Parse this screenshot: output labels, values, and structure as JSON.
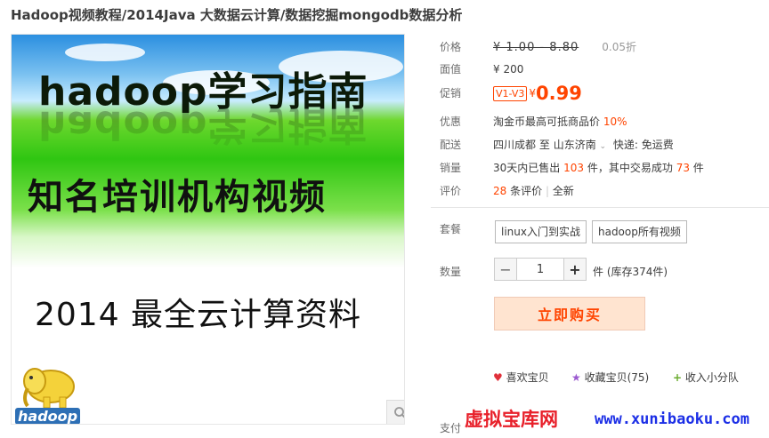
{
  "title": "Hadoop视频教程/2014Java 大数据云计算/数据挖掘mongodb数据分析",
  "image": {
    "heading": "hadoop学习指南",
    "subheading": "知名培训机构视频",
    "tagline": "2014 最全云计算资料",
    "logo_text": "hadoop"
  },
  "price": {
    "label": "价格",
    "original": "¥ 1.00 - 8.80",
    "discount": "0.05折"
  },
  "face_value": {
    "label": "面值",
    "value": "¥ 200"
  },
  "promo": {
    "label": "促销",
    "tag": "V1-V3",
    "currency": "¥",
    "price": "0.99"
  },
  "benefit": {
    "label": "优惠",
    "text": "淘金币最高可抵商品价",
    "percent": "10%"
  },
  "shipping": {
    "label": "配送",
    "from": "四川成都",
    "to_word": "至",
    "dest": "山东济南",
    "express": "快递: 免运费"
  },
  "sales": {
    "label": "销量",
    "prefix": "30天内已售出",
    "sold": "103",
    "mid": "件，其中交易成功",
    "success": "73",
    "suffix": "件"
  },
  "rating": {
    "label": "评价",
    "count": "28",
    "text": "条评价",
    "sep": "|",
    "all": "全新"
  },
  "package": {
    "label": "套餐",
    "options": [
      "linux入门到实战",
      "hadoop所有视频"
    ]
  },
  "quantity": {
    "label": "数量",
    "minus": "−",
    "value": "1",
    "plus": "+",
    "stock": "件 (库存374件)"
  },
  "buy_label": "立即购买",
  "social": {
    "like": "喜欢宝贝",
    "collect": "收藏宝贝(75)",
    "share": "收入小分队"
  },
  "payment_label": "支付",
  "watermark": {
    "name": "虚拟宝库网",
    "url": "www.xunibaoku.com"
  },
  "colors": {
    "accent": "#ff4400",
    "buy_bg": "#ffe4d0",
    "watermark_red": "#e8202a",
    "watermark_blue": "#1b2ee6"
  }
}
